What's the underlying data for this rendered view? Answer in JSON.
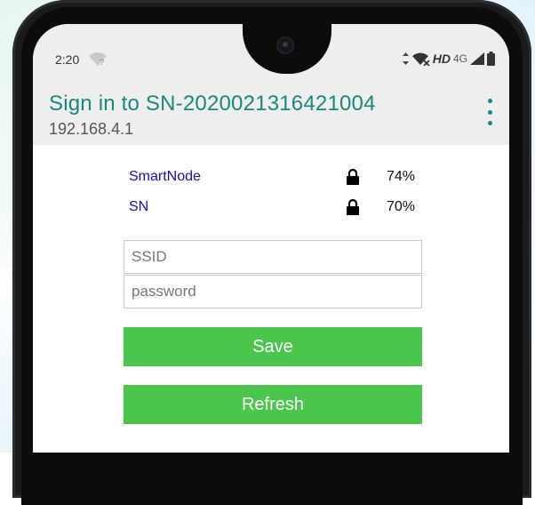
{
  "status_bar": {
    "time": "2:20",
    "hd_label": "HD",
    "network_label": "4G"
  },
  "app_bar": {
    "title": "Sign in to SN-2020021316421004",
    "subtitle": "192.168.4.1"
  },
  "networks": [
    {
      "ssid": "SmartNode",
      "signal": "74%",
      "icon": "lock-icon"
    },
    {
      "ssid": "SN",
      "signal": "70%",
      "icon": "lock-icon"
    }
  ],
  "form": {
    "ssid_placeholder": "SSID",
    "password_placeholder": "password",
    "save_label": "Save",
    "refresh_label": "Refresh"
  },
  "colors": {
    "accent": "#17897b",
    "button": "#4bc54b",
    "link": "#1a0dab"
  }
}
